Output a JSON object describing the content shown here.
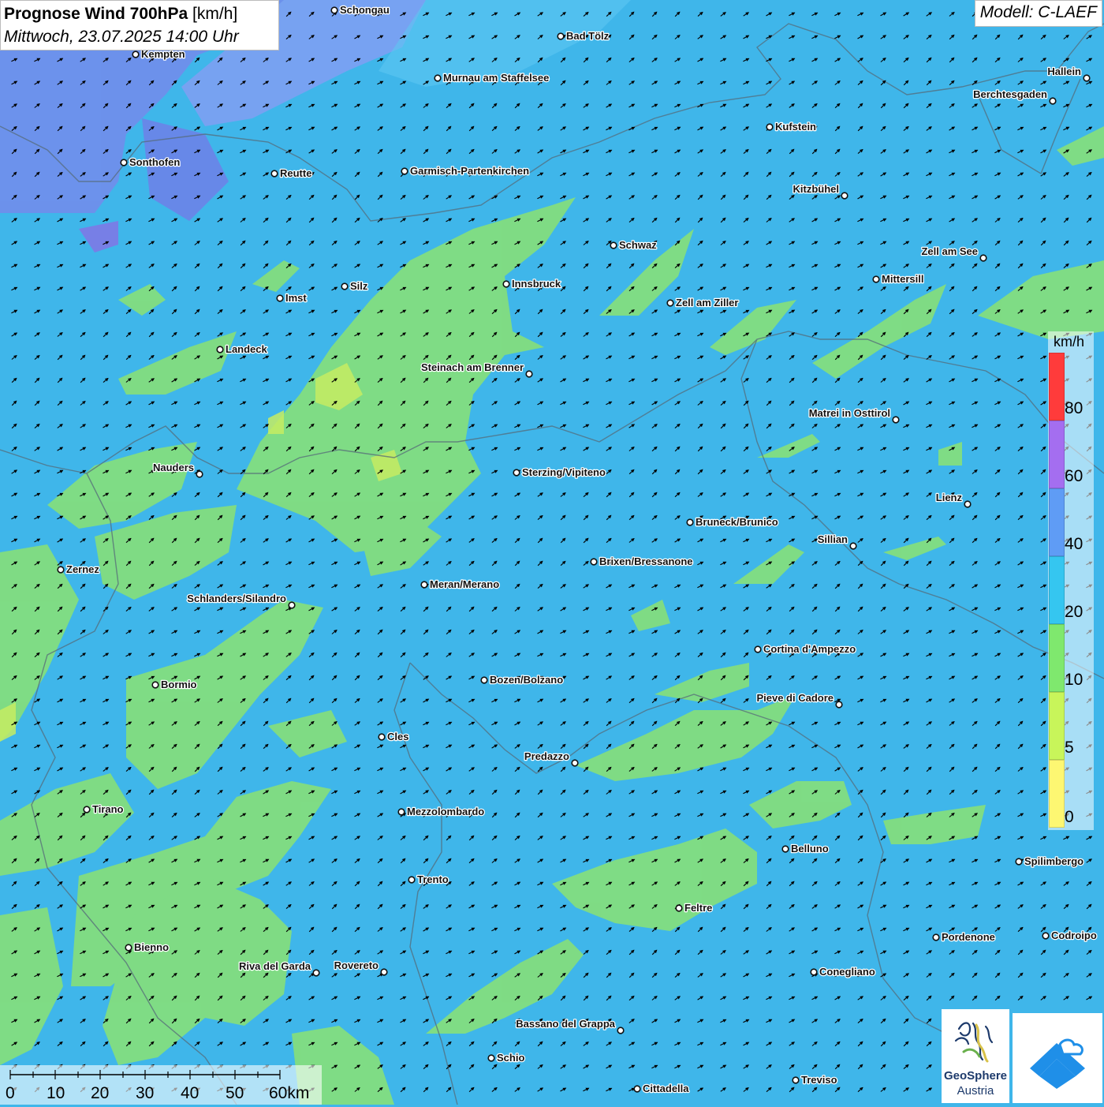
{
  "title": {
    "prefix": "Prognose Wind 700hPa",
    "unit": "[km/h]",
    "datetime": "Mittwoch, 23.07.2025 14:00 Uhr"
  },
  "model": "Modell: C-LAEF",
  "legend": {
    "unit": "km/h",
    "labels": [
      "80",
      "60",
      "40",
      "20",
      "10",
      "5",
      "0"
    ],
    "colors": [
      "#ff3b3b",
      "#a46ef0",
      "#5f9cf5",
      "#35c6f0",
      "#7fe86e",
      "#c8f55a",
      "#fdf772"
    ]
  },
  "scale_bar": {
    "labels": [
      "0",
      "10",
      "20",
      "30",
      "40",
      "50",
      "60km"
    ]
  },
  "cities": [
    {
      "name": "Schongau"
    },
    {
      "name": "Bad Tölz"
    },
    {
      "name": "Kempten"
    },
    {
      "name": "Murnau am Staffelsee"
    },
    {
      "name": "Hallein"
    },
    {
      "name": "Berchtesgaden"
    },
    {
      "name": "Kufstein"
    },
    {
      "name": "Sonthofen"
    },
    {
      "name": "Reutte"
    },
    {
      "name": "Garmisch-Partenkirchen"
    },
    {
      "name": "Kitzbühel"
    },
    {
      "name": "Schwaz"
    },
    {
      "name": "Zell am See"
    },
    {
      "name": "Mittersill"
    },
    {
      "name": "Innsbruck"
    },
    {
      "name": "Silz"
    },
    {
      "name": "Imst"
    },
    {
      "name": "Zell am Ziller"
    },
    {
      "name": "Landeck"
    },
    {
      "name": "Steinach am Brenner"
    },
    {
      "name": "Matrei in Osttirol"
    },
    {
      "name": "Nauders"
    },
    {
      "name": "Sterzing/Vipiteno"
    },
    {
      "name": "Lienz"
    },
    {
      "name": "Bruneck/Brunico"
    },
    {
      "name": "Sillian"
    },
    {
      "name": "Zernez"
    },
    {
      "name": "Brixen/Bressanone"
    },
    {
      "name": "Meran/Merano"
    },
    {
      "name": "Schlanders/Silandro"
    },
    {
      "name": "Cortina d'Ampezzo"
    },
    {
      "name": "Bormio"
    },
    {
      "name": "Bozen/Bolzano"
    },
    {
      "name": "Pieve di Cadore"
    },
    {
      "name": "Cles"
    },
    {
      "name": "Predazzo"
    },
    {
      "name": "Tirano"
    },
    {
      "name": "Mezzolombardo"
    },
    {
      "name": "Belluno"
    },
    {
      "name": "Spilimbergo"
    },
    {
      "name": "Trento"
    },
    {
      "name": "Feltre"
    },
    {
      "name": "Bienno"
    },
    {
      "name": "Pordenone"
    },
    {
      "name": "Codroipo"
    },
    {
      "name": "Riva del Garda"
    },
    {
      "name": "Rovereto"
    },
    {
      "name": "Conegliano"
    },
    {
      "name": "Bassano del Grappa"
    },
    {
      "name": "Schio"
    },
    {
      "name": "Treviso"
    },
    {
      "name": "Cittadella"
    }
  ],
  "wind": {
    "direction": "southwest",
    "dominant_range_kmh": "20-40"
  },
  "logo": {
    "brand": "GeoSphere",
    "subtitle": "Austria"
  }
}
